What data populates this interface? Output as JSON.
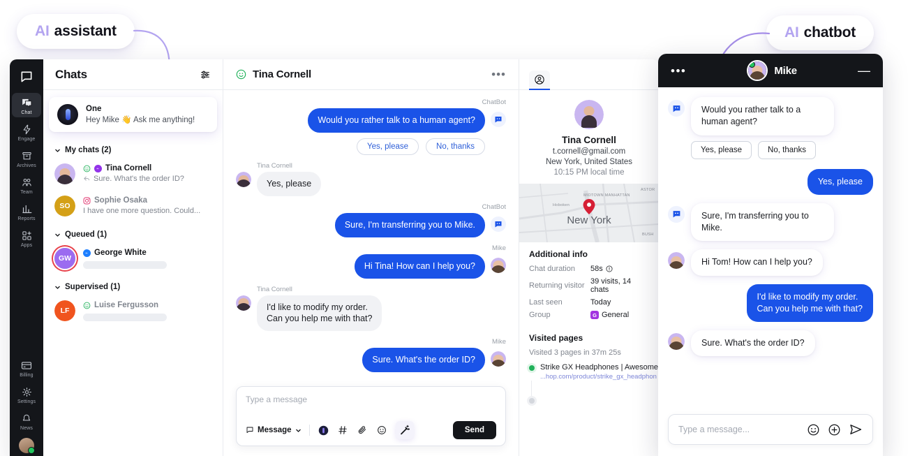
{
  "badges": {
    "assistant": {
      "ai": "AI",
      "rest": "assistant"
    },
    "chatbot": {
      "ai": "AI",
      "rest": "chatbot"
    }
  },
  "colors": {
    "accent_blue": "#1a53e8",
    "dark": "#14161a",
    "purple": "#b3a4f0",
    "online_green": "#21c55d",
    "pin_red": "#d61f35"
  },
  "sidebar": {
    "logo_icon": "livechat-logo-icon",
    "items": [
      {
        "label": "Chat",
        "icon": "chat-icon",
        "active": true
      },
      {
        "label": "Engage",
        "icon": "lightning-icon",
        "active": false
      },
      {
        "label": "Archives",
        "icon": "archive-icon",
        "active": false
      },
      {
        "label": "Team",
        "icon": "team-icon",
        "active": false
      },
      {
        "label": "Reports",
        "icon": "bar-chart-icon",
        "active": false
      },
      {
        "label": "Apps",
        "icon": "apps-grid-icon",
        "active": false
      }
    ],
    "bottom_items": [
      {
        "label": "Billing",
        "icon": "credit-card-icon"
      },
      {
        "label": "Settings",
        "icon": "gear-icon"
      },
      {
        "label": "News",
        "icon": "bell-icon"
      }
    ]
  },
  "chats_panel": {
    "title": "Chats",
    "filter_icon": "sliders-icon",
    "ai_assistant": {
      "name": "One",
      "preview": "Hey Mike 👋 Ask me anything!",
      "avatar_icon": "one-ai-avatar"
    },
    "groups": [
      {
        "label": "My chats (2)",
        "chevron_icon": "chevron-down-icon",
        "rows": [
          {
            "name": "Tina Cornell",
            "preview": "Sure. What's the order ID?",
            "status_icon": "smiley-green-icon",
            "channel_icon": "messenger-icon",
            "reply_icon": "reply-arrow-icon",
            "avatar_type": "photo",
            "muted": false
          },
          {
            "name": "Sophie Osaka",
            "preview": "I have one more question. Could...",
            "channel_icon": "instagram-icon",
            "avatar_type": "initials",
            "initials": "SO",
            "avatar_color": "#d4a017",
            "muted": true
          }
        ]
      },
      {
        "label": "Queued (1)",
        "chevron_icon": "chevron-down-icon",
        "rows": [
          {
            "name": "George White",
            "preview": "",
            "channel_icon": "messenger-icon",
            "avatar_type": "initials",
            "initials": "GW",
            "avatar_color": "#9b6bf0",
            "ring": true,
            "muted": true
          }
        ]
      },
      {
        "label": "Supervised (1)",
        "chevron_icon": "chevron-down-icon",
        "rows": [
          {
            "name": "Luise  Fergusson",
            "preview": "",
            "status_icon": "smiley-green-icon",
            "avatar_type": "initials",
            "initials": "LF",
            "avatar_color": "#f0541e",
            "muted": true
          }
        ]
      }
    ]
  },
  "conversation": {
    "status_icon": "smiley-green-icon",
    "title": "Tina Cornell",
    "more_icon": "ellipsis-icon",
    "messages": [
      {
        "author": "ChatBot",
        "side": "right",
        "text": "Would you rather talk to a human agent?",
        "style": "blue",
        "avatar": "chatbot-icon"
      },
      {
        "author": "",
        "side": "right",
        "type": "quick_replies",
        "options": [
          "Yes, please",
          "No, thanks"
        ]
      },
      {
        "author": "Tina Cornell",
        "side": "left",
        "text": "Yes, please",
        "style": "grey",
        "avatar": "tina-avatar"
      },
      {
        "author": "ChatBot",
        "side": "right",
        "text": "Sure, I'm transferring you to Mike.",
        "style": "blue",
        "avatar": "chatbot-icon"
      },
      {
        "author": "Mike",
        "side": "right",
        "text": "Hi Tina! How can I help you?",
        "style": "blue",
        "avatar": "mike-avatar"
      },
      {
        "author": "Tina Cornell",
        "side": "left",
        "text": "I'd like to modify my order.\nCan you help me with that?",
        "style": "grey",
        "avatar": "tina-avatar"
      },
      {
        "author": "Mike",
        "side": "right",
        "text": "Sure. What's the order ID?",
        "style": "blue",
        "avatar": "mike-avatar"
      }
    ],
    "composer": {
      "placeholder": "Type a message",
      "value": "",
      "mode_label": "Message",
      "mode_chevron_icon": "chevron-down-icon",
      "mode_icon": "speech-bubble-icon",
      "tools": [
        {
          "icon": "one-ai-pill-icon",
          "name": "ai-assist"
        },
        {
          "icon": "hash-icon",
          "name": "canned-response"
        },
        {
          "icon": "paperclip-icon",
          "name": "attach-file"
        },
        {
          "icon": "emoji-icon",
          "name": "emoji-picker"
        },
        {
          "icon": "magic-wand-icon",
          "name": "ai-rewrite",
          "highlighted": true
        }
      ],
      "send_label": "Send"
    }
  },
  "details": {
    "tab_icon": "person-circle-icon",
    "profile": {
      "name": "Tina Cornell",
      "email": "t.cornell@gmail.com",
      "location": "New York, United States",
      "local_time": "10:15 PM local time"
    },
    "map": {
      "city_label": "New York",
      "pin_icon": "map-pin-icon",
      "labels": [
        "Hoboken",
        "MIDTOWN MANHATTAN",
        "ASTOR",
        "BUSH"
      ]
    },
    "additional_info": {
      "heading": "Additional info",
      "rows": [
        {
          "key": "Chat duration",
          "value": "58s",
          "icon": "info-circle-icon"
        },
        {
          "key": "Returning visitor",
          "value": "39 visits, 14 chats"
        },
        {
          "key": "Last seen",
          "value": "Today"
        },
        {
          "key": "Group",
          "value": "General",
          "chip": "G"
        }
      ]
    },
    "visited_pages": {
      "heading": "Visited pages",
      "summary": "Visited 3 pages in 37m 25s",
      "items": [
        {
          "title": "Strike GX Headphones | Awesome",
          "url": "...hop.com/product/strike_gx_headphon",
          "active": true
        },
        {
          "title": "",
          "url": "",
          "active": false
        }
      ]
    }
  },
  "widget": {
    "menu_icon": "ellipsis-icon",
    "agent_name": "Mike",
    "agent_avatar": "mike-avatar",
    "online_indicator": "online-dot",
    "minimize_icon": "minimize-icon",
    "messages": [
      {
        "from": "bot",
        "text": "Would you rather talk to a human agent?",
        "avatar": "chatbot-icon"
      },
      {
        "type": "quick_replies",
        "options": [
          "Yes, please",
          "No, thanks"
        ]
      },
      {
        "from": "visitor",
        "text": "Yes, please"
      },
      {
        "from": "bot",
        "text": "Sure, I'm transferring you to Mike.",
        "avatar": "chatbot-icon"
      },
      {
        "from": "agent",
        "text": "Hi Tom! How can I help you?",
        "avatar": "mike-avatar"
      },
      {
        "from": "visitor",
        "text": "I'd like to modify my order.\nCan you help me with that?"
      },
      {
        "from": "agent",
        "text": "Sure. What's the order ID?",
        "avatar": "mike-avatar"
      }
    ],
    "input": {
      "placeholder": "Type a message...",
      "value": "",
      "emoji_icon": "emoji-icon",
      "plus_icon": "plus-circle-icon",
      "send_icon": "send-arrow-icon"
    }
  }
}
